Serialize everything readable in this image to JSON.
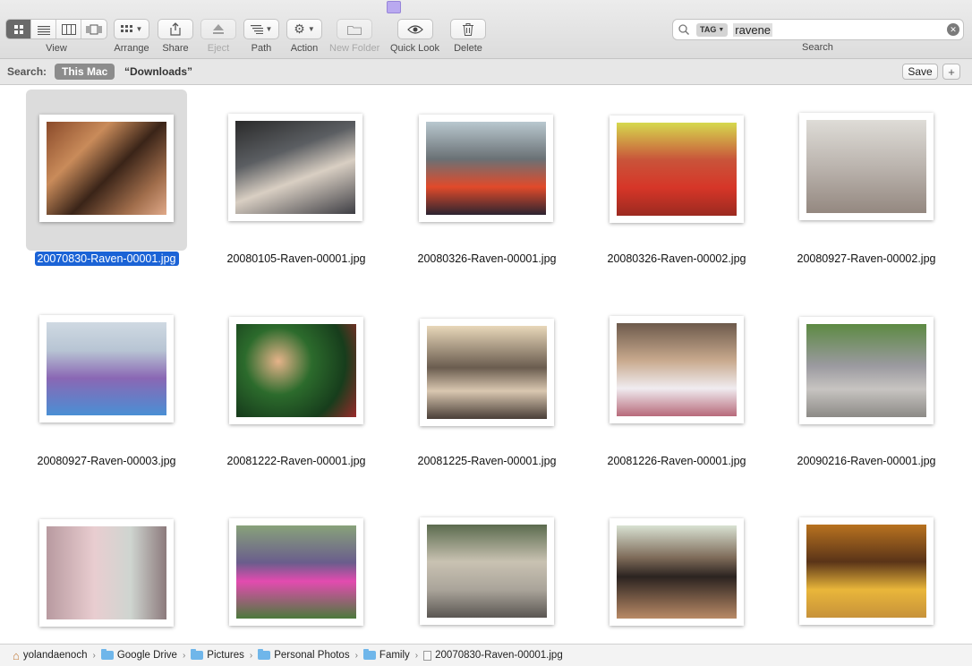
{
  "toolbar": {
    "view_label": "View",
    "arrange_label": "Arrange",
    "share_label": "Share",
    "eject_label": "Eject",
    "path_label": "Path",
    "action_label": "Action",
    "new_folder_label": "New Folder",
    "quick_look_label": "Quick Look",
    "delete_label": "Delete",
    "search_label": "Search",
    "search_token": "TAG",
    "search_value": "ravene"
  },
  "scope": {
    "label": "Search:",
    "this_mac": "This Mac",
    "downloads": "“Downloads”",
    "save": "Save",
    "add": "+"
  },
  "files": [
    {
      "name": "20070830-Raven-00001.jpg",
      "selected": true
    },
    {
      "name": "20080105-Raven-00001.jpg"
    },
    {
      "name": "20080326-Raven-00001.jpg"
    },
    {
      "name": "20080326-Raven-00002.jpg"
    },
    {
      "name": "20080927-Raven-00002.jpg"
    },
    {
      "name": "20080927-Raven-00003.jpg"
    },
    {
      "name": "20081222-Raven-00001.jpg"
    },
    {
      "name": "20081225-Raven-00001.jpg"
    },
    {
      "name": "20081226-Raven-00001.jpg"
    },
    {
      "name": "20090216-Raven-00001.jpg"
    },
    {
      "name": ""
    },
    {
      "name": ""
    },
    {
      "name": ""
    },
    {
      "name": ""
    },
    {
      "name": ""
    }
  ],
  "pathbar": [
    "yolandaenoch",
    "Google Drive",
    "Pictures",
    "Personal Photos",
    "Family",
    "20070830-Raven-00001.jpg"
  ],
  "colors": {
    "selection": "#1b63d6",
    "folder": "#6fb6ea"
  }
}
